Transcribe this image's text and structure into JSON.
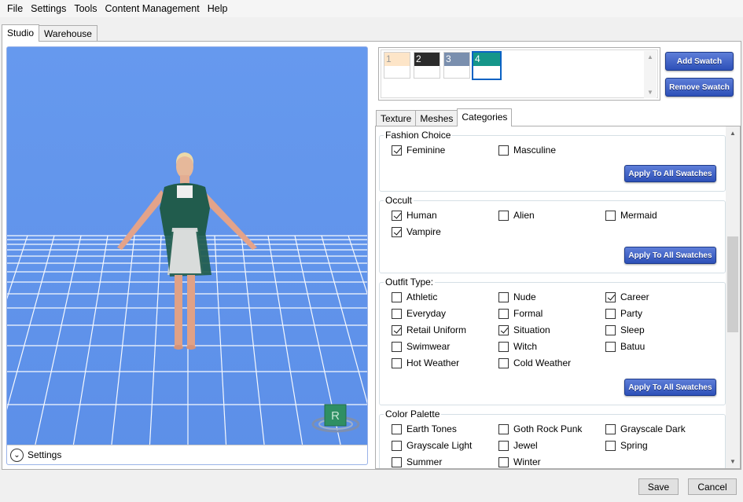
{
  "menu": [
    "File",
    "Settings",
    "Tools",
    "Content Management",
    "Help"
  ],
  "outer_tabs": [
    "Studio",
    "Warehouse"
  ],
  "viewport": {
    "settings_label": "Settings",
    "gizmo_letter": "R"
  },
  "swatches": [
    {
      "num": "1",
      "color": "#fde5c8"
    },
    {
      "num": "2",
      "color": "#2b2b2b"
    },
    {
      "num": "3",
      "color": "#7a8fae"
    },
    {
      "num": "4",
      "color": "#15968a",
      "selected": true
    }
  ],
  "buttons": {
    "add_swatch": "Add Swatch",
    "remove_swatch": "Remove Swatch",
    "apply_all": "Apply To All Swatches"
  },
  "inner_tabs": [
    "Texture",
    "Meshes",
    "Categories"
  ],
  "groups": {
    "fashion": {
      "title": "Fashion Choice",
      "items": [
        [
          "Feminine",
          true
        ],
        [
          "Masculine",
          false
        ]
      ]
    },
    "occult": {
      "title": "Occult",
      "items": [
        [
          "Human",
          true
        ],
        [
          "Alien",
          false
        ],
        [
          "Mermaid",
          false
        ],
        [
          "Vampire",
          true
        ]
      ]
    },
    "outfit": {
      "title": "Outfit Type:",
      "items": [
        [
          "Athletic",
          false
        ],
        [
          "Nude",
          false
        ],
        [
          "Career",
          true
        ],
        [
          "Everyday",
          false
        ],
        [
          "Formal",
          false
        ],
        [
          "Party",
          false
        ],
        [
          "Retail Uniform",
          true
        ],
        [
          "Situation",
          true
        ],
        [
          "Sleep",
          false
        ],
        [
          "Swimwear",
          false
        ],
        [
          "Witch",
          false
        ],
        [
          "Batuu",
          false
        ],
        [
          "Hot Weather",
          false
        ],
        [
          "Cold Weather",
          false
        ]
      ]
    },
    "palette": {
      "title": "Color Palette",
      "items": [
        [
          "Earth Tones",
          false
        ],
        [
          "Goth Rock Punk",
          false
        ],
        [
          "Grayscale Dark",
          false
        ],
        [
          "Grayscale Light",
          false
        ],
        [
          "Jewel",
          false
        ],
        [
          "Spring",
          false
        ],
        [
          "Summer",
          false
        ],
        [
          "Winter",
          false
        ]
      ]
    }
  },
  "footer": {
    "save": "Save",
    "cancel": "Cancel"
  }
}
